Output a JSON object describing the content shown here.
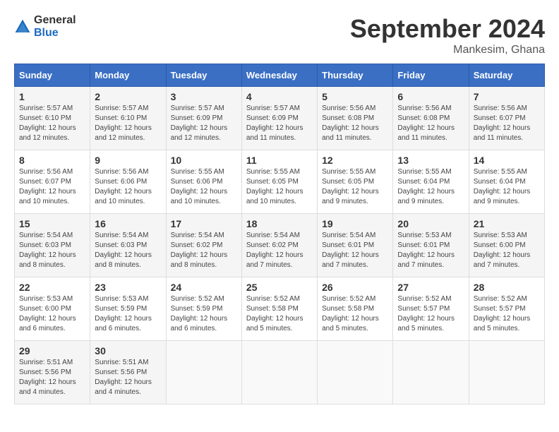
{
  "logo": {
    "general": "General",
    "blue": "Blue"
  },
  "header": {
    "month": "September 2024",
    "location": "Mankesim, Ghana"
  },
  "days_of_week": [
    "Sunday",
    "Monday",
    "Tuesday",
    "Wednesday",
    "Thursday",
    "Friday",
    "Saturday"
  ],
  "weeks": [
    [
      {
        "day": "1",
        "sunrise": "5:57 AM",
        "sunset": "6:10 PM",
        "daylight": "12 hours and 12 minutes."
      },
      {
        "day": "2",
        "sunrise": "5:57 AM",
        "sunset": "6:10 PM",
        "daylight": "12 hours and 12 minutes."
      },
      {
        "day": "3",
        "sunrise": "5:57 AM",
        "sunset": "6:09 PM",
        "daylight": "12 hours and 12 minutes."
      },
      {
        "day": "4",
        "sunrise": "5:57 AM",
        "sunset": "6:09 PM",
        "daylight": "12 hours and 11 minutes."
      },
      {
        "day": "5",
        "sunrise": "5:56 AM",
        "sunset": "6:08 PM",
        "daylight": "12 hours and 11 minutes."
      },
      {
        "day": "6",
        "sunrise": "5:56 AM",
        "sunset": "6:08 PM",
        "daylight": "12 hours and 11 minutes."
      },
      {
        "day": "7",
        "sunrise": "5:56 AM",
        "sunset": "6:07 PM",
        "daylight": "12 hours and 11 minutes."
      }
    ],
    [
      {
        "day": "8",
        "sunrise": "5:56 AM",
        "sunset": "6:07 PM",
        "daylight": "12 hours and 10 minutes."
      },
      {
        "day": "9",
        "sunrise": "5:56 AM",
        "sunset": "6:06 PM",
        "daylight": "12 hours and 10 minutes."
      },
      {
        "day": "10",
        "sunrise": "5:55 AM",
        "sunset": "6:06 PM",
        "daylight": "12 hours and 10 minutes."
      },
      {
        "day": "11",
        "sunrise": "5:55 AM",
        "sunset": "6:05 PM",
        "daylight": "12 hours and 10 minutes."
      },
      {
        "day": "12",
        "sunrise": "5:55 AM",
        "sunset": "6:05 PM",
        "daylight": "12 hours and 9 minutes."
      },
      {
        "day": "13",
        "sunrise": "5:55 AM",
        "sunset": "6:04 PM",
        "daylight": "12 hours and 9 minutes."
      },
      {
        "day": "14",
        "sunrise": "5:55 AM",
        "sunset": "6:04 PM",
        "daylight": "12 hours and 9 minutes."
      }
    ],
    [
      {
        "day": "15",
        "sunrise": "5:54 AM",
        "sunset": "6:03 PM",
        "daylight": "12 hours and 8 minutes."
      },
      {
        "day": "16",
        "sunrise": "5:54 AM",
        "sunset": "6:03 PM",
        "daylight": "12 hours and 8 minutes."
      },
      {
        "day": "17",
        "sunrise": "5:54 AM",
        "sunset": "6:02 PM",
        "daylight": "12 hours and 8 minutes."
      },
      {
        "day": "18",
        "sunrise": "5:54 AM",
        "sunset": "6:02 PM",
        "daylight": "12 hours and 7 minutes."
      },
      {
        "day": "19",
        "sunrise": "5:54 AM",
        "sunset": "6:01 PM",
        "daylight": "12 hours and 7 minutes."
      },
      {
        "day": "20",
        "sunrise": "5:53 AM",
        "sunset": "6:01 PM",
        "daylight": "12 hours and 7 minutes."
      },
      {
        "day": "21",
        "sunrise": "5:53 AM",
        "sunset": "6:00 PM",
        "daylight": "12 hours and 7 minutes."
      }
    ],
    [
      {
        "day": "22",
        "sunrise": "5:53 AM",
        "sunset": "6:00 PM",
        "daylight": "12 hours and 6 minutes."
      },
      {
        "day": "23",
        "sunrise": "5:53 AM",
        "sunset": "5:59 PM",
        "daylight": "12 hours and 6 minutes."
      },
      {
        "day": "24",
        "sunrise": "5:52 AM",
        "sunset": "5:59 PM",
        "daylight": "12 hours and 6 minutes."
      },
      {
        "day": "25",
        "sunrise": "5:52 AM",
        "sunset": "5:58 PM",
        "daylight": "12 hours and 5 minutes."
      },
      {
        "day": "26",
        "sunrise": "5:52 AM",
        "sunset": "5:58 PM",
        "daylight": "12 hours and 5 minutes."
      },
      {
        "day": "27",
        "sunrise": "5:52 AM",
        "sunset": "5:57 PM",
        "daylight": "12 hours and 5 minutes."
      },
      {
        "day": "28",
        "sunrise": "5:52 AM",
        "sunset": "5:57 PM",
        "daylight": "12 hours and 5 minutes."
      }
    ],
    [
      {
        "day": "29",
        "sunrise": "5:51 AM",
        "sunset": "5:56 PM",
        "daylight": "12 hours and 4 minutes."
      },
      {
        "day": "30",
        "sunrise": "5:51 AM",
        "sunset": "5:56 PM",
        "daylight": "12 hours and 4 minutes."
      },
      null,
      null,
      null,
      null,
      null
    ]
  ]
}
